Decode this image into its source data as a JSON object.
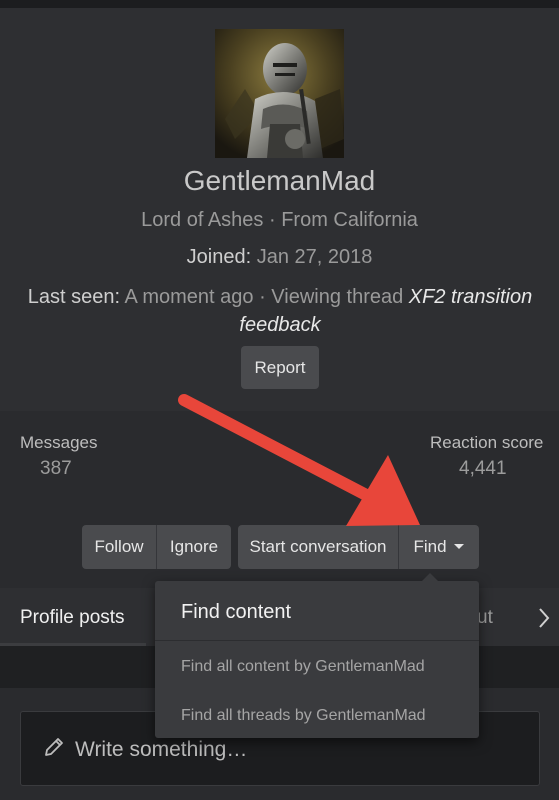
{
  "profile": {
    "username": "GentlemanMad",
    "title_line": "Lord of Ashes · From California",
    "joined_label": "Joined:",
    "joined_value": "Jan 27, 2018",
    "last_seen_label": "Last seen:",
    "last_seen_value": "A moment ago · Viewing thread",
    "last_seen_thread": "XF2 transition feedback",
    "report_label": "Report"
  },
  "stats": {
    "messages_label": "Messages",
    "messages_value": "387",
    "reaction_label": "Reaction score",
    "reaction_value": "4,441"
  },
  "actions": {
    "follow": "Follow",
    "ignore": "Ignore",
    "start_conversation": "Start conversation",
    "find": "Find"
  },
  "tabs": {
    "profile_posts": "Profile posts",
    "partial_tab": "ut",
    "next_icon": "chevron-right-icon"
  },
  "find_menu": {
    "header": "Find content",
    "items": [
      "Find all content by GentlemanMad",
      "Find all threads by GentlemanMad"
    ]
  },
  "composer": {
    "placeholder": "Write something…",
    "icon": "pencil-icon"
  },
  "colors": {
    "background": "#2a2b2e",
    "button": "#4a4b4e",
    "annotation_arrow": "#e8463a"
  }
}
